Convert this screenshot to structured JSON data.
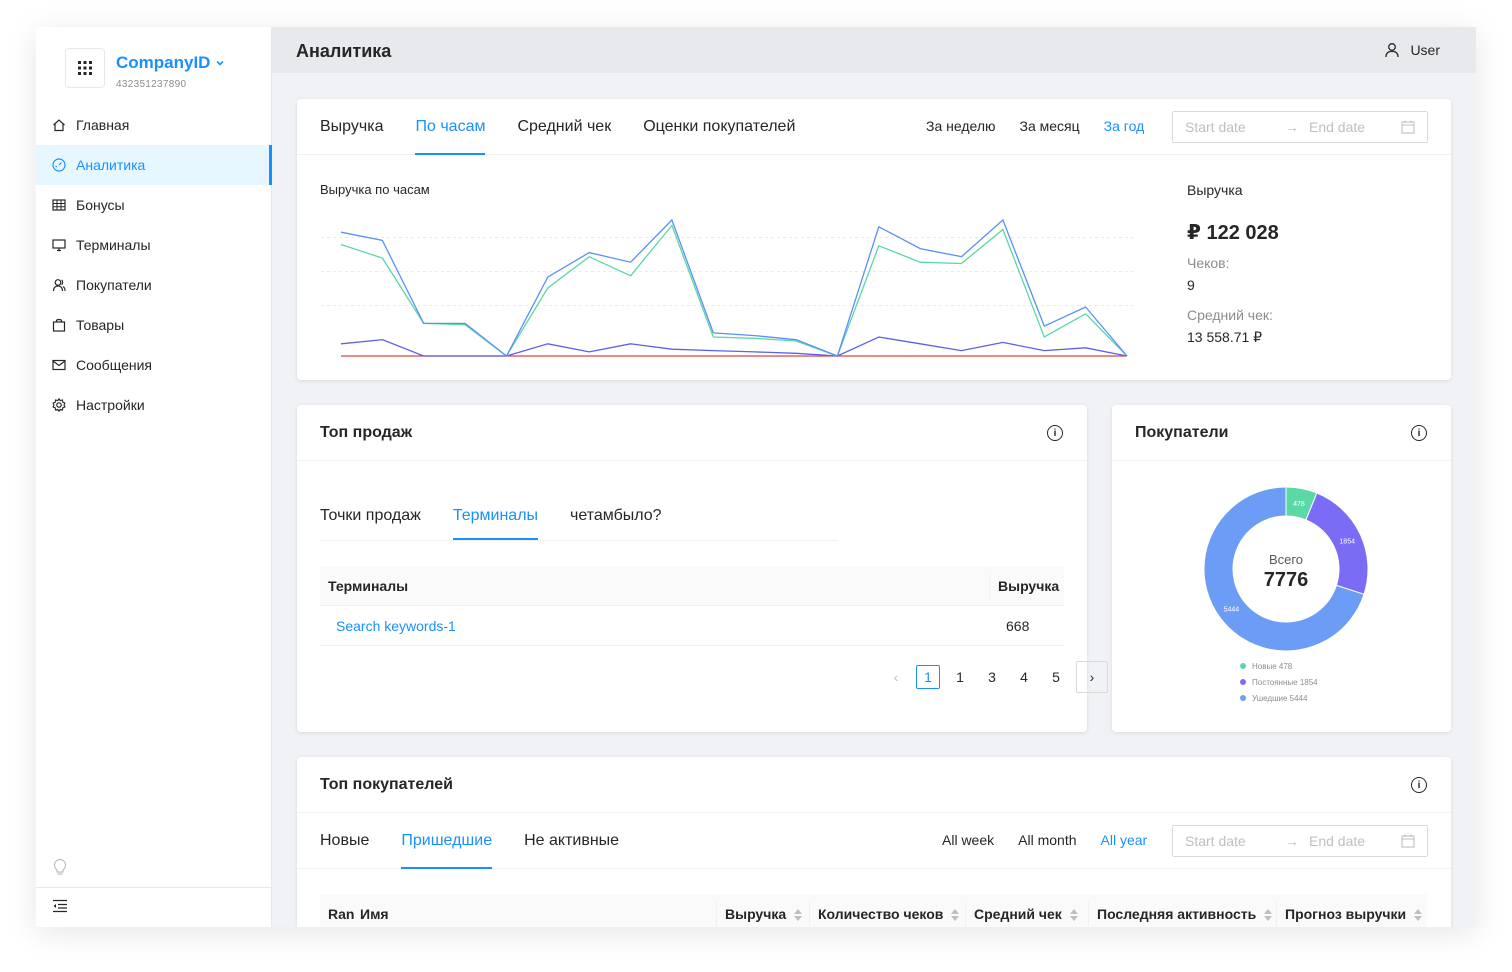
{
  "sidebar": {
    "company_name": "CompanyID",
    "company_id": "432351237890",
    "items": [
      {
        "label": "Главная",
        "icon": "home-icon"
      },
      {
        "label": "Аналитика",
        "icon": "dashboard-icon"
      },
      {
        "label": "Бонусы",
        "icon": "table-icon"
      },
      {
        "label": "Терминалы",
        "icon": "desktop-icon"
      },
      {
        "label": "Покупатели",
        "icon": "users-icon"
      },
      {
        "label": "Товары",
        "icon": "shopping-bag-icon"
      },
      {
        "label": "Сообщения",
        "icon": "mail-icon"
      },
      {
        "label": "Настройки",
        "icon": "settings-icon"
      }
    ]
  },
  "header": {
    "title": "Аналитика",
    "user": "User"
  },
  "revenue": {
    "tabs": [
      "Выручка",
      "По часам",
      "Средний чек",
      "Оценки покупателей"
    ],
    "active_tab": 1,
    "periods": [
      "За неделю",
      "За месяц",
      "За год"
    ],
    "active_period": 2,
    "start_placeholder": "Start date",
    "end_placeholder": "End date",
    "chart_caption": "Выручка по часам",
    "summary_label": "Выручка",
    "summary_value": "₽ 122 028",
    "checks_label": "Чеков:",
    "checks_value": "9",
    "avg_label": "Средний чек:",
    "avg_value": "13 558.71 ₽"
  },
  "chart_data": {
    "type": "line",
    "x": [
      0,
      1,
      2,
      3,
      4,
      5,
      6,
      7,
      8,
      9,
      10,
      11,
      12,
      13,
      14,
      15,
      16,
      17,
      18,
      19
    ],
    "ylim": [
      0,
      100
    ],
    "grid": true,
    "series": [
      {
        "color": "#5b8ff9",
        "values": [
          91,
          85,
          24,
          24,
          0,
          58,
          76,
          69,
          100,
          17,
          15,
          12,
          0,
          95,
          79,
          73,
          100,
          22,
          36,
          0
        ]
      },
      {
        "color": "#5ad8a6",
        "values": [
          82,
          72,
          24,
          23,
          0,
          50,
          73,
          59,
          96,
          14,
          13,
          11,
          0,
          81,
          69,
          68,
          93,
          14,
          31,
          0
        ]
      },
      {
        "color": "#5d5fef",
        "values": [
          9,
          12,
          0,
          0,
          0,
          9,
          3,
          9,
          5,
          4,
          3,
          2,
          0,
          14,
          9,
          4,
          10,
          4,
          6,
          0
        ]
      },
      {
        "color": "#d64545",
        "values": [
          0,
          0,
          0,
          0,
          0,
          0,
          0,
          0,
          0,
          0,
          0,
          0,
          0,
          0,
          0,
          0,
          0,
          0,
          0,
          0
        ]
      }
    ]
  },
  "top_sales": {
    "title": "Топ продаж",
    "tabs": [
      "Точки продаж",
      "Терминалы",
      "четамбыло?"
    ],
    "active_tab": 1,
    "columns": [
      "Терминалы",
      "Выручка"
    ],
    "rows": [
      {
        "name": "Search keywords-1",
        "value": "668"
      }
    ],
    "pages": [
      "1",
      "1",
      "3",
      "4",
      "5"
    ]
  },
  "buyers": {
    "title": "Покупатели",
    "total_label": "Всего",
    "total_value": "7776",
    "slices": [
      {
        "label": "Новые",
        "value": 478,
        "color": "#5ad8a6"
      },
      {
        "label": "Постоянные",
        "value": 1854,
        "color": "#7b6cf6"
      },
      {
        "label": "Ушедшие",
        "value": 5444,
        "color": "#6b9cf6"
      }
    ],
    "legend": [
      "Новые 478",
      "Постоянные 1854",
      "Ушедшие 5444"
    ]
  },
  "top_buyers": {
    "title": "Топ покупателей",
    "tabs": [
      "Новые",
      "Пришедшие",
      "Не активные"
    ],
    "active_tab": 1,
    "periods": [
      "All week",
      "All month",
      "All year"
    ],
    "active_period": 2,
    "start_placeholder": "Start date",
    "end_placeholder": "End date",
    "columns": [
      "Ran",
      "Имя",
      "Выручка",
      "Количество чеков",
      "Средний чек",
      "Последняя активность",
      "Прогноз выручки"
    ]
  }
}
